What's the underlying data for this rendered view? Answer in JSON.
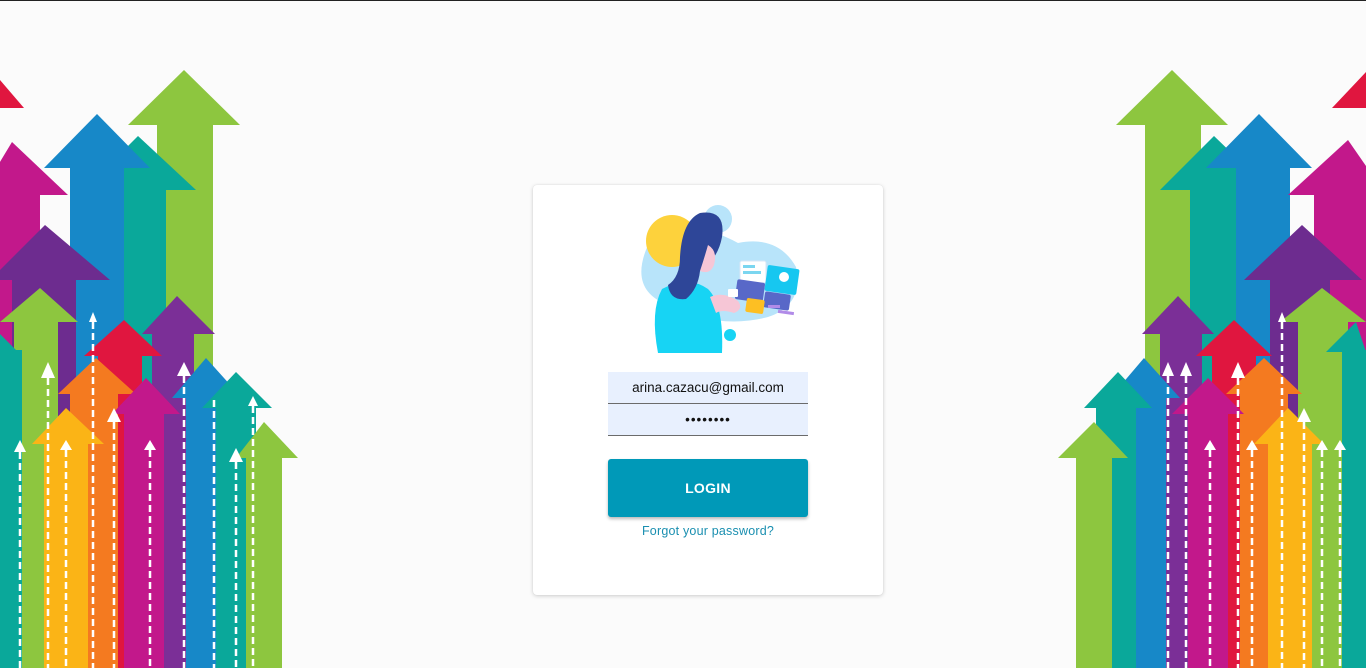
{
  "login": {
    "email_value": "arina.cazacu@gmail.com",
    "password_value": "••••••••",
    "login_label": "LOGIN",
    "forgot_label": "Forgot your password?"
  },
  "colors": {
    "background": "#fbfbfb",
    "card": "#ffffff",
    "input_fill": "#e8f0fe",
    "button": "#0099b8",
    "link": "#1a8fb0"
  },
  "icons": {
    "illustration": "woman-with-media-tablet-illustration",
    "decoration": "colorful-upward-arrows"
  }
}
